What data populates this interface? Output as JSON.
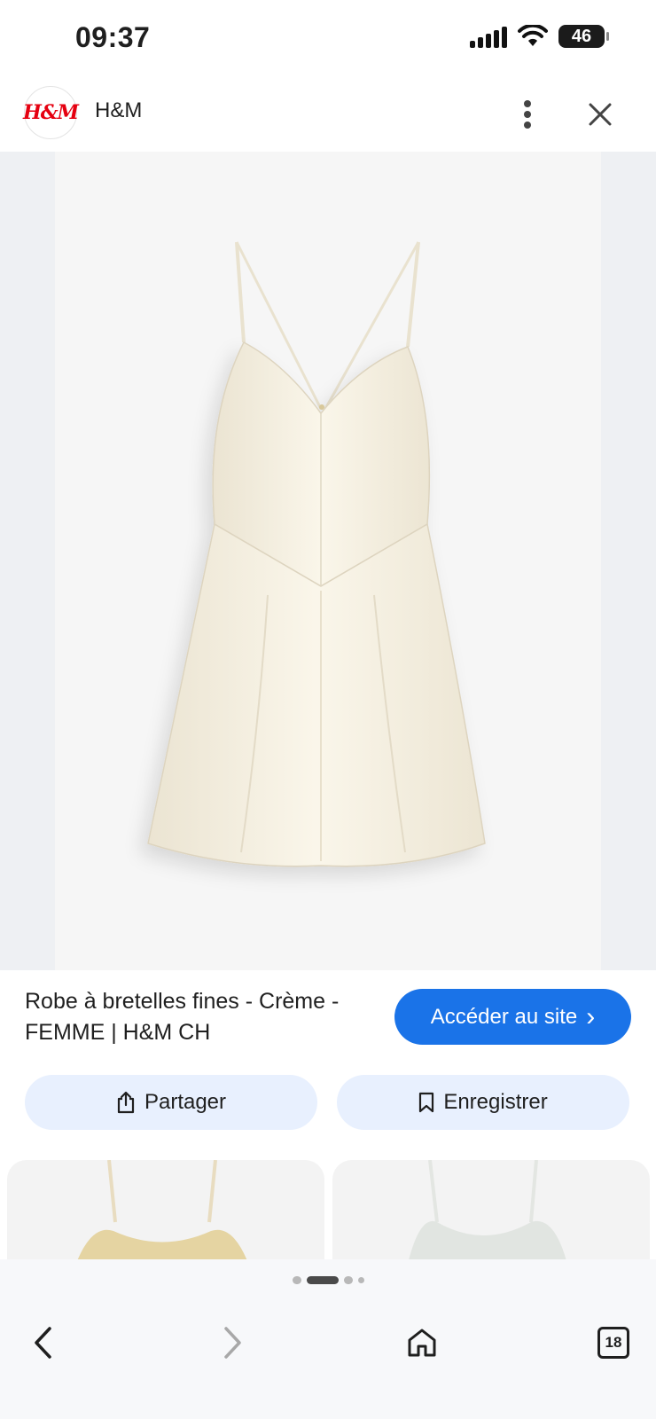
{
  "status_bar": {
    "time": "09:37",
    "battery": "46"
  },
  "header": {
    "logo_text": "H&M",
    "site_name": "H&M"
  },
  "product": {
    "title": "Robe à bretelles fines - Crème - FEMME | H&M CH",
    "visit_label": "Accéder au site",
    "visit_chevron": "›"
  },
  "actions": {
    "share_label": "Partager",
    "save_label": "Enregistrer"
  },
  "bottom_nav": {
    "tab_count": "18"
  },
  "colors": {
    "accent": "#1a73e8",
    "chip_bg": "#e8f0fe",
    "brand_red": "#e50010"
  },
  "icons": [
    "more-vertical-icon",
    "close-icon",
    "share-icon",
    "bookmark-icon",
    "back-icon",
    "forward-icon",
    "home-icon",
    "tabs-icon"
  ]
}
